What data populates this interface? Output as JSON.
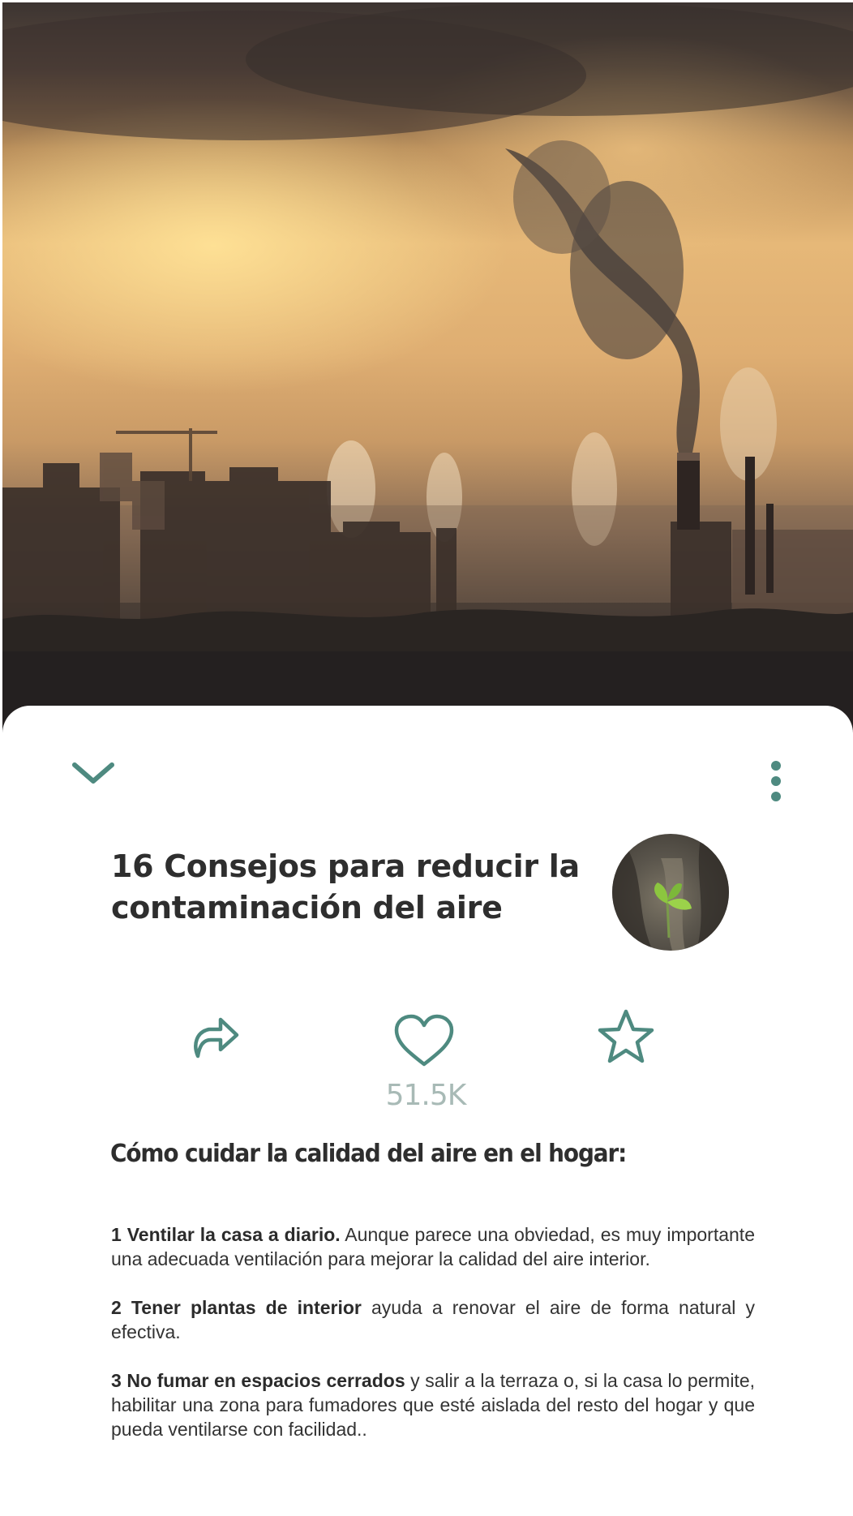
{
  "colors": {
    "accent": "#4e8a80",
    "title_text": "#2e2e2e",
    "count_text": "#a8bab6",
    "body_text": "#333333",
    "sheet_background": "#ffffff"
  },
  "hero": {
    "image_alt": "smokestacks-city-pollution-photo"
  },
  "toolbar": {
    "collapse_icon": "chevron-down-icon",
    "more_icon": "vertical-dots-icon"
  },
  "article": {
    "title": "16 Consejos para reducir la contaminación del aire",
    "avatar_icon": "sprout-avatar"
  },
  "actions": {
    "share_icon": "share-arrow-icon",
    "like_icon": "heart-outline-icon",
    "favorite_icon": "star-outline-icon",
    "like_count": "51.5K"
  },
  "content": {
    "heading": "Cómo cuidar la calidad del aire en el hogar:",
    "tips": [
      {
        "bold": "1 Ventilar la casa a diario.",
        "text": " Aunque parece una obviedad, es muy importante una adecuada ventilación para mejorar la calidad del aire interior."
      },
      {
        "bold": "2 Tener plantas de interior",
        "text": " ayuda a renovar el aire de forma natural y efectiva."
      },
      {
        "bold": "3 No fumar en espacios cerrados",
        "text": " y salir a la terraza o, si la casa lo permite, habilitar una zona para fumadores que esté aislada del resto del hogar y que pueda ventilarse con facilidad.."
      }
    ]
  }
}
